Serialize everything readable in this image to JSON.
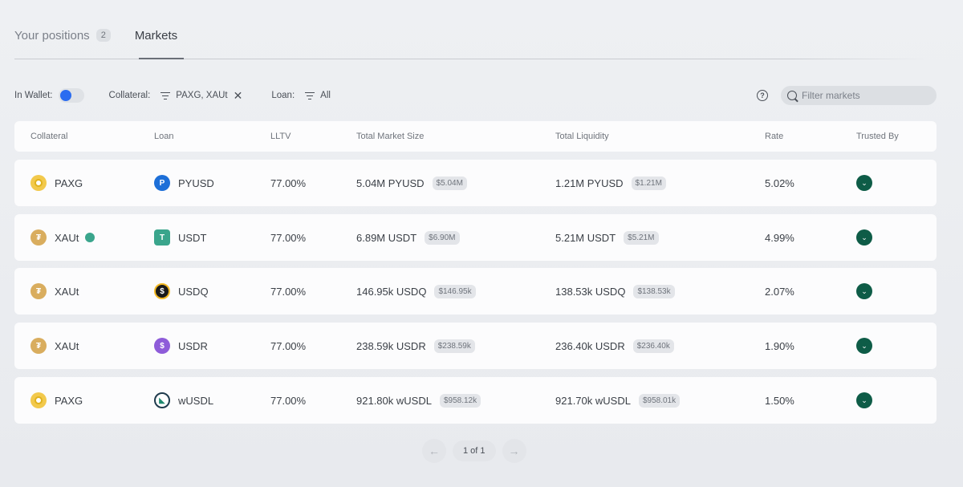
{
  "tabs": [
    {
      "label": "Your positions",
      "count": "2"
    },
    {
      "label": "Markets"
    }
  ],
  "filters": {
    "in_wallet_label": "In Wallet:",
    "collateral_label": "Collateral:",
    "collateral_value": "PAXG, XAUt",
    "loan_label": "Loan:",
    "loan_value": "All",
    "search_placeholder": "Filter markets"
  },
  "table": {
    "headers": [
      "Collateral",
      "Loan",
      "LLTV",
      "Total Market Size",
      "Total Liquidity",
      "Rate",
      "Trusted By"
    ],
    "rows": [
      {
        "collateral": "PAXG",
        "collateral_icon": "paxg-icon",
        "loan": "PYUSD",
        "loan_icon": "pyusd-icon",
        "lltv": "77.00%",
        "size": "5.04M PYUSD",
        "size_usd": "$5.04M",
        "liquidity": "1.21M PYUSD",
        "liquidity_usd": "$1.21M",
        "rate": "5.02%"
      },
      {
        "collateral": "XAUt",
        "collateral_icon": "xaut-icon",
        "loan": "USDT",
        "loan_icon": "usdt-icon",
        "lltv": "77.00%",
        "size": "6.89M USDT",
        "size_usd": "$6.90M",
        "liquidity": "5.21M USDT",
        "liquidity_usd": "$5.21M",
        "rate": "4.99%"
      },
      {
        "collateral": "XAUt",
        "collateral_icon": "xaut-icon",
        "loan": "USDQ",
        "loan_icon": "usdq-icon",
        "lltv": "77.00%",
        "size": "146.95k USDQ",
        "size_usd": "$146.95k",
        "liquidity": "138.53k USDQ",
        "liquidity_usd": "$138.53k",
        "rate": "2.07%"
      },
      {
        "collateral": "XAUt",
        "collateral_icon": "xaut-icon",
        "loan": "USDR",
        "loan_icon": "usdr-icon",
        "lltv": "77.00%",
        "size": "238.59k USDR",
        "size_usd": "$238.59k",
        "liquidity": "236.40k USDR",
        "liquidity_usd": "$236.40k",
        "rate": "1.90%"
      },
      {
        "collateral": "PAXG",
        "collateral_icon": "paxg-icon",
        "loan": "wUSDL",
        "loan_icon": "wusdl-icon",
        "lltv": "77.00%",
        "size": "921.80k wUSDL",
        "size_usd": "$958.12k",
        "liquidity": "921.70k wUSDL",
        "liquidity_usd": "$958.01k",
        "rate": "1.50%"
      }
    ]
  },
  "pagination": {
    "label": "1 of 1"
  },
  "colors": {
    "accent": "#2b6cf0",
    "trusted": "#0e5c47",
    "status_dot": "#3aa58c"
  }
}
